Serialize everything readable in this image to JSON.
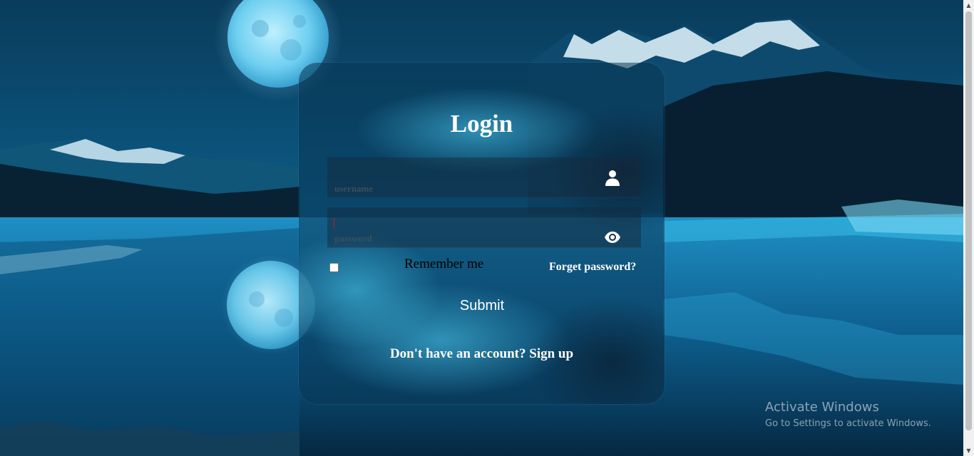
{
  "login_form": {
    "title": "Login",
    "username": {
      "value": "",
      "placeholder": "username",
      "icon": "user-icon"
    },
    "password": {
      "value": "",
      "placeholder": "password",
      "icon": "eye-icon"
    },
    "remember_me": {
      "label": "Remember me",
      "checked": false
    },
    "forgot_password_label": "Forget password?",
    "submit_label": "Submit",
    "signup_prompt": "Don't have an account?",
    "signup_link_label": "Sign up"
  },
  "watermark": {
    "title": "Activate Windows",
    "subtitle": "Go to Settings to activate Windows."
  },
  "colors": {
    "text": "#ffffff",
    "placeholder": "#3b4e5f",
    "background_deep": "#062a44",
    "water_highlight": "#2fb7e6"
  }
}
